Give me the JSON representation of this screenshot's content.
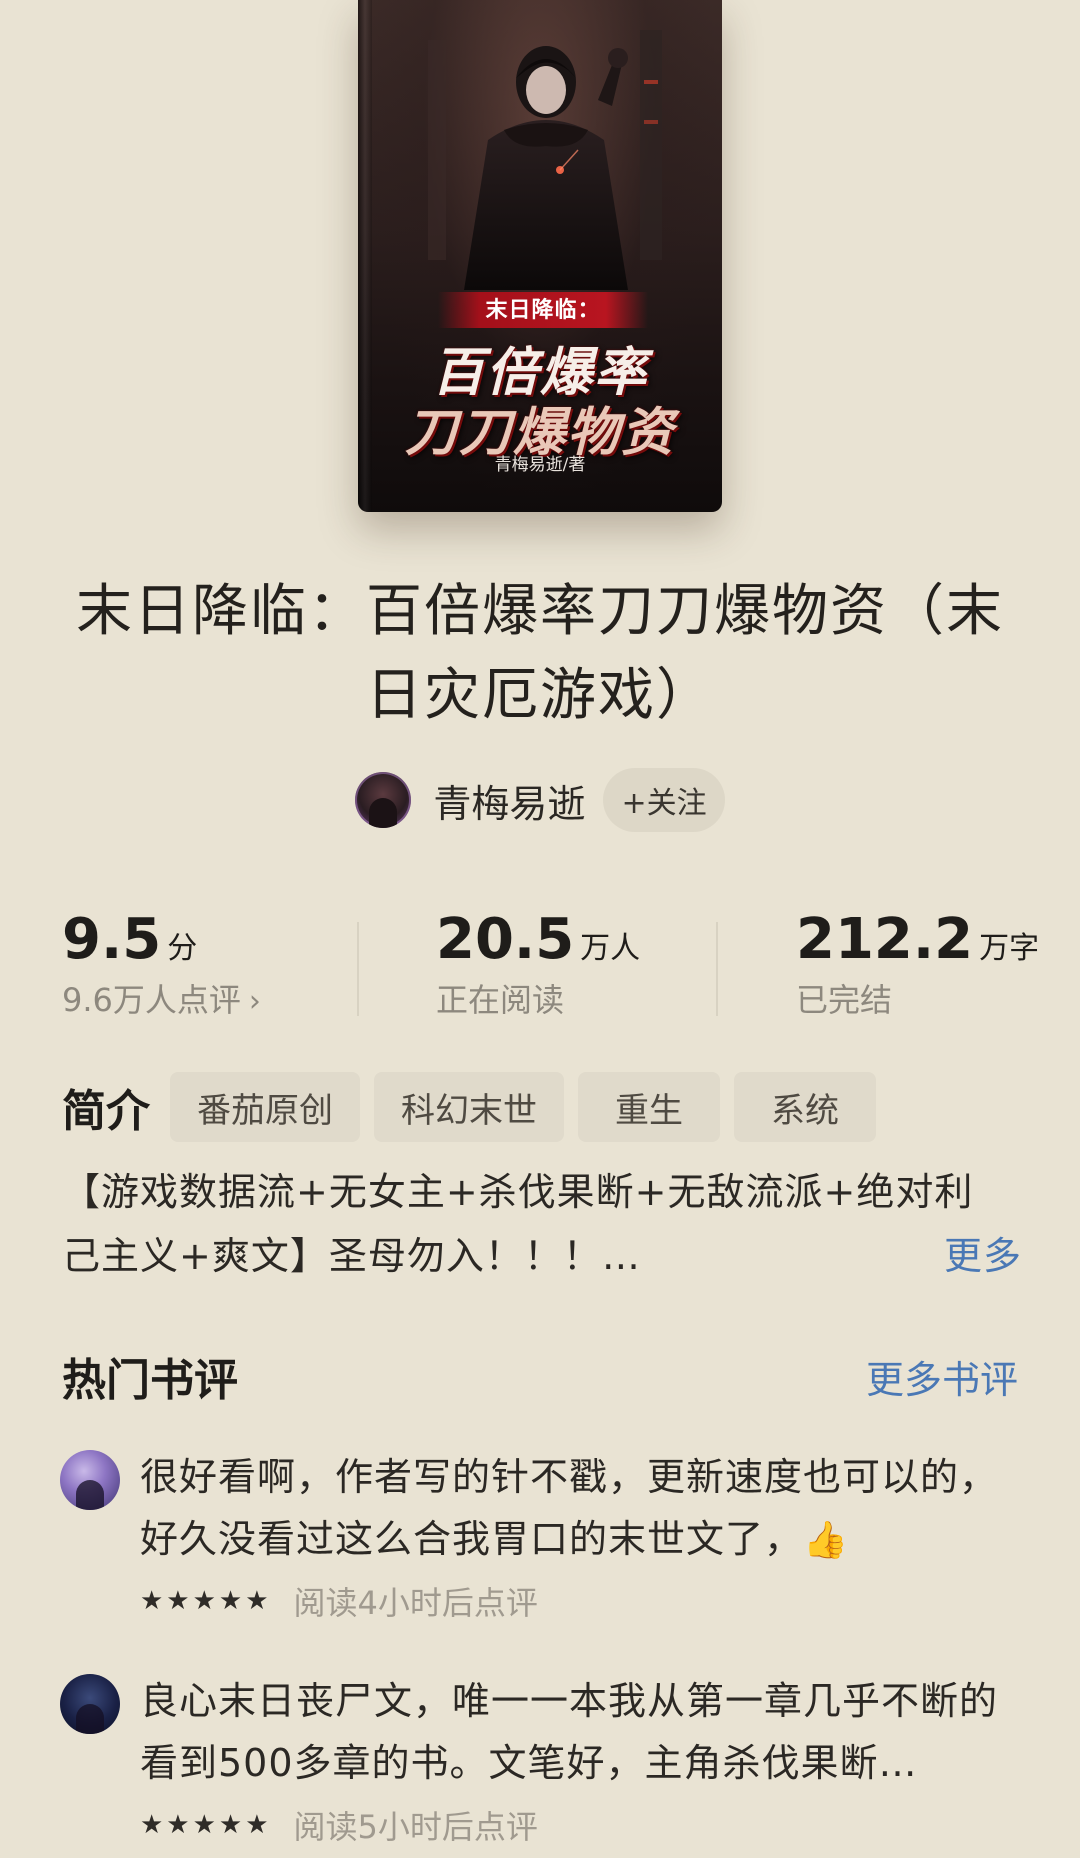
{
  "cover": {
    "banner": "末日降临：",
    "title_line1": "百倍爆率",
    "title_line2": "刀刀爆物资",
    "author_credit": "青梅易逝/著"
  },
  "book": {
    "title": "末日降临：百倍爆率刀刀爆物资（末日灾厄游戏）"
  },
  "author": {
    "name": "青梅易逝",
    "follow_label": "+关注"
  },
  "stats": {
    "rating": {
      "value": "9.5",
      "unit": "分",
      "sub": "9.6万人点评"
    },
    "readers": {
      "value": "20.5",
      "unit": "万人",
      "sub": "正在阅读"
    },
    "words": {
      "value": "212.2",
      "unit": "万字",
      "sub": "已完结"
    }
  },
  "intro": {
    "label": "简介",
    "tags": [
      "番茄原创",
      "科幻末世",
      "重生",
      "系统"
    ],
    "line1": "【游戏数据流+无女主+杀伐果断+无敌流派+绝对利",
    "line2": "己主义+爽文】圣母勿入！！！…",
    "more_label": "更多"
  },
  "reviews": {
    "title": "热门书评",
    "more_label": "更多书评",
    "items": [
      {
        "text": "很好看啊，作者写的针不戳，更新速度也可以的，好久没看过这么合我胃口的末世文了，",
        "emoji": "👍",
        "stars": 5,
        "meta": "阅读4小时后点评"
      },
      {
        "text": "良心末日丧尸文，唯一一本我从第一章几乎不断的看到500多章的书。文笔好，主角杀伐果断…",
        "stars": 5,
        "meta": "阅读5小时后点评"
      }
    ]
  },
  "icons": {
    "chevron": "chevron-right-icon",
    "star": "star-icon"
  },
  "colors": {
    "background": "#e9e3d3",
    "link": "#4a78b5",
    "muted": "#8d887e"
  }
}
